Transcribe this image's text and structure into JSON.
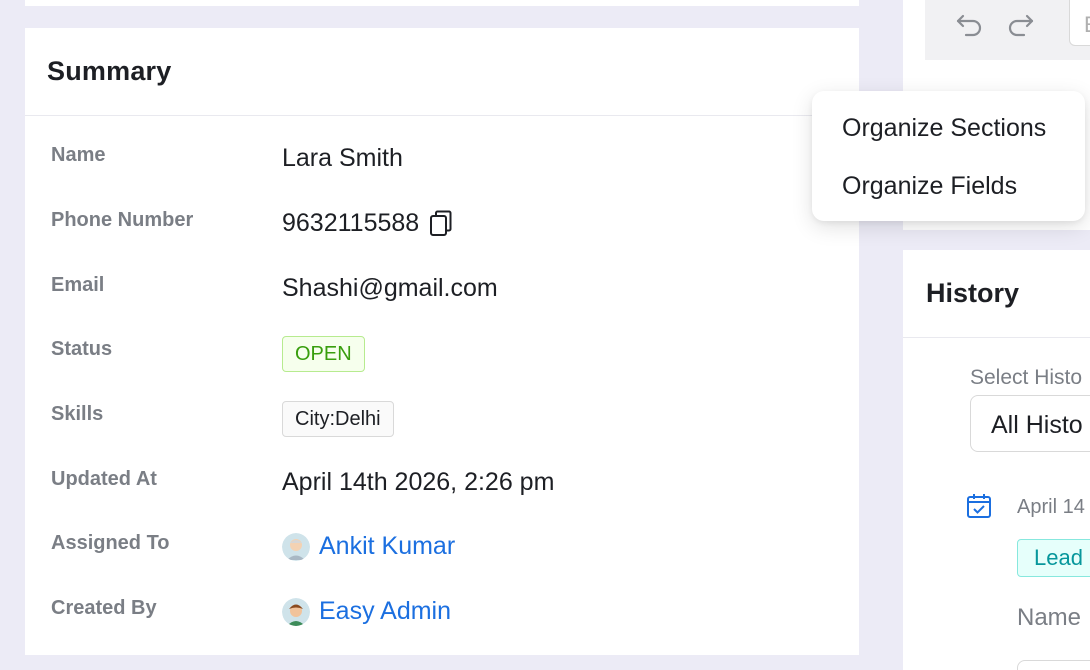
{
  "summary": {
    "title": "Summary",
    "fields": [
      {
        "label": "Name",
        "value": "Lara Smith"
      },
      {
        "label": "Phone Number",
        "value": "9632115588"
      },
      {
        "label": "Email",
        "value": "Shashi@gmail.com"
      },
      {
        "label": "Status",
        "value": "OPEN"
      },
      {
        "label": "Skills",
        "value": "City:Delhi"
      },
      {
        "label": "Updated At",
        "value": "April 14th 2026, 2:26 pm"
      },
      {
        "label": "Assigned To",
        "value": "Ankit Kumar"
      },
      {
        "label": "Created By",
        "value": "Easy Admin"
      }
    ]
  },
  "menu": {
    "items": [
      "Organize Sections",
      "Organize Fields"
    ]
  },
  "toolbar": {
    "input_text": "E"
  },
  "history": {
    "title": "History",
    "select_label": "Select Histo",
    "select_value": "All Histo",
    "entry_date": "April 14",
    "entry_tag": "Lead",
    "entry_field_label": "Name"
  },
  "colors": {
    "accent_link": "#1b6fe0",
    "status_open": "#389e0d",
    "background": "#ecebf6"
  }
}
